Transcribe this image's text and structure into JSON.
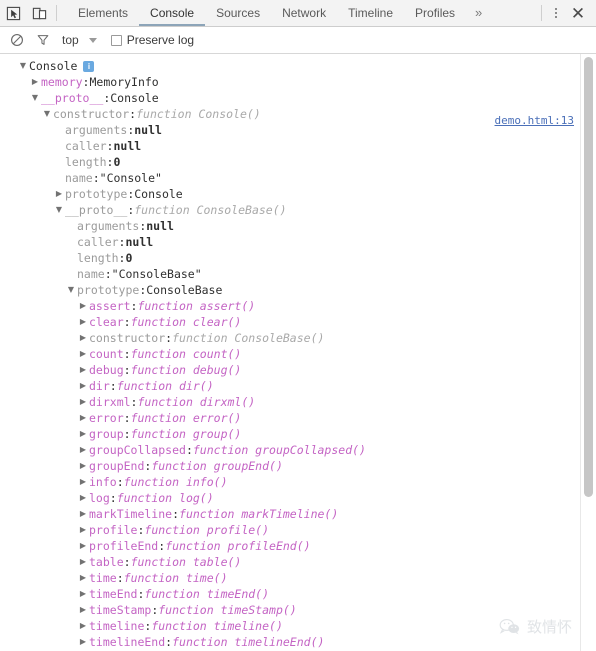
{
  "window": {
    "title": "Chrome DevTools - Console"
  },
  "toolbar": {
    "inspect_icon": "inspect-cursor-icon",
    "device_icon": "device-toolbar-icon",
    "tabs": [
      {
        "label": "Elements",
        "active": false
      },
      {
        "label": "Console",
        "active": true
      },
      {
        "label": "Sources",
        "active": false
      },
      {
        "label": "Network",
        "active": false
      },
      {
        "label": "Timeline",
        "active": false
      },
      {
        "label": "Profiles",
        "active": false
      }
    ],
    "more_tabs_label": "»",
    "menu_icon": "vertical-dots-icon",
    "close_label": "✕",
    "active_tab_underline": "#8ca4b8"
  },
  "filterbar": {
    "clear_icon": "clear-console-icon",
    "filter_icon": "filter-funnel-icon",
    "context_value": "top",
    "context_caret": "chevron-down-icon",
    "preserve_log_label": "Preserve log",
    "preserve_log_checked": false
  },
  "console": {
    "source_link": "demo.html:13",
    "lines": [
      {
        "indent": 1,
        "tri": "open",
        "name": "Console",
        "name_style": "lbl",
        "sep": "",
        "value": "",
        "value_style": "",
        "badge": "i"
      },
      {
        "indent": 2,
        "tri": "closed",
        "name": "memory",
        "name_style": "nm",
        "sep": ": ",
        "value": "MemoryInfo",
        "value_style": "val"
      },
      {
        "indent": 2,
        "tri": "open",
        "name": "__proto__",
        "name_style": "nm",
        "sep": ": ",
        "value": "Console",
        "value_style": "val"
      },
      {
        "indent": 3,
        "tri": "open",
        "name": "constructor",
        "name_style": "nm-grey",
        "sep": ": ",
        "value": "function Console()",
        "value_style": "val-fn-grey"
      },
      {
        "indent": 4,
        "tri": "none",
        "name": "arguments",
        "name_style": "nm-grey",
        "sep": ": ",
        "value": "null",
        "value_style": "val-null"
      },
      {
        "indent": 4,
        "tri": "none",
        "name": "caller",
        "name_style": "nm-grey",
        "sep": ": ",
        "value": "null",
        "value_style": "val-null"
      },
      {
        "indent": 4,
        "tri": "none",
        "name": "length",
        "name_style": "nm-grey",
        "sep": ": ",
        "value": "0",
        "value_style": "val-null"
      },
      {
        "indent": 4,
        "tri": "none",
        "name": "name",
        "name_style": "nm-grey",
        "sep": ": ",
        "value": "\"Console\"",
        "value_style": "val-str"
      },
      {
        "indent": 4,
        "tri": "closed",
        "name": "prototype",
        "name_style": "nm-grey",
        "sep": ": ",
        "value": "Console",
        "value_style": "val"
      },
      {
        "indent": 4,
        "tri": "open",
        "name": "__proto__",
        "name_style": "nm-grey",
        "sep": ": ",
        "value": "function ConsoleBase()",
        "value_style": "val-fn-grey"
      },
      {
        "indent": 5,
        "tri": "none",
        "name": "arguments",
        "name_style": "nm-grey",
        "sep": ": ",
        "value": "null",
        "value_style": "val-null"
      },
      {
        "indent": 5,
        "tri": "none",
        "name": "caller",
        "name_style": "nm-grey",
        "sep": ": ",
        "value": "null",
        "value_style": "val-null"
      },
      {
        "indent": 5,
        "tri": "none",
        "name": "length",
        "name_style": "nm-grey",
        "sep": ": ",
        "value": "0",
        "value_style": "val-null"
      },
      {
        "indent": 5,
        "tri": "none",
        "name": "name",
        "name_style": "nm-grey",
        "sep": ": ",
        "value": "\"ConsoleBase\"",
        "value_style": "val-str"
      },
      {
        "indent": 5,
        "tri": "open",
        "name": "prototype",
        "name_style": "nm-grey",
        "sep": ": ",
        "value": "ConsoleBase",
        "value_style": "val"
      },
      {
        "indent": 6,
        "tri": "closed",
        "name": "assert",
        "name_style": "nm",
        "sep": ": ",
        "value": "function assert()",
        "value_style": "val-fn"
      },
      {
        "indent": 6,
        "tri": "closed",
        "name": "clear",
        "name_style": "nm",
        "sep": ": ",
        "value": "function clear()",
        "value_style": "val-fn"
      },
      {
        "indent": 6,
        "tri": "closed",
        "name": "constructor",
        "name_style": "nm-grey",
        "sep": ": ",
        "value": "function ConsoleBase()",
        "value_style": "val-fn-grey"
      },
      {
        "indent": 6,
        "tri": "closed",
        "name": "count",
        "name_style": "nm",
        "sep": ": ",
        "value": "function count()",
        "value_style": "val-fn"
      },
      {
        "indent": 6,
        "tri": "closed",
        "name": "debug",
        "name_style": "nm",
        "sep": ": ",
        "value": "function debug()",
        "value_style": "val-fn"
      },
      {
        "indent": 6,
        "tri": "closed",
        "name": "dir",
        "name_style": "nm",
        "sep": ": ",
        "value": "function dir()",
        "value_style": "val-fn"
      },
      {
        "indent": 6,
        "tri": "closed",
        "name": "dirxml",
        "name_style": "nm",
        "sep": ": ",
        "value": "function dirxml()",
        "value_style": "val-fn"
      },
      {
        "indent": 6,
        "tri": "closed",
        "name": "error",
        "name_style": "nm",
        "sep": ": ",
        "value": "function error()",
        "value_style": "val-fn"
      },
      {
        "indent": 6,
        "tri": "closed",
        "name": "group",
        "name_style": "nm",
        "sep": ": ",
        "value": "function group()",
        "value_style": "val-fn"
      },
      {
        "indent": 6,
        "tri": "closed",
        "name": "groupCollapsed",
        "name_style": "nm",
        "sep": ": ",
        "value": "function groupCollapsed()",
        "value_style": "val-fn"
      },
      {
        "indent": 6,
        "tri": "closed",
        "name": "groupEnd",
        "name_style": "nm",
        "sep": ": ",
        "value": "function groupEnd()",
        "value_style": "val-fn"
      },
      {
        "indent": 6,
        "tri": "closed",
        "name": "info",
        "name_style": "nm",
        "sep": ": ",
        "value": "function info()",
        "value_style": "val-fn"
      },
      {
        "indent": 6,
        "tri": "closed",
        "name": "log",
        "name_style": "nm",
        "sep": ": ",
        "value": "function log()",
        "value_style": "val-fn"
      },
      {
        "indent": 6,
        "tri": "closed",
        "name": "markTimeline",
        "name_style": "nm",
        "sep": ": ",
        "value": "function markTimeline()",
        "value_style": "val-fn"
      },
      {
        "indent": 6,
        "tri": "closed",
        "name": "profile",
        "name_style": "nm",
        "sep": ": ",
        "value": "function profile()",
        "value_style": "val-fn"
      },
      {
        "indent": 6,
        "tri": "closed",
        "name": "profileEnd",
        "name_style": "nm",
        "sep": ": ",
        "value": "function profileEnd()",
        "value_style": "val-fn"
      },
      {
        "indent": 6,
        "tri": "closed",
        "name": "table",
        "name_style": "nm",
        "sep": ": ",
        "value": "function table()",
        "value_style": "val-fn"
      },
      {
        "indent": 6,
        "tri": "closed",
        "name": "time",
        "name_style": "nm",
        "sep": ": ",
        "value": "function time()",
        "value_style": "val-fn"
      },
      {
        "indent": 6,
        "tri": "closed",
        "name": "timeEnd",
        "name_style": "nm",
        "sep": ": ",
        "value": "function timeEnd()",
        "value_style": "val-fn"
      },
      {
        "indent": 6,
        "tri": "closed",
        "name": "timeStamp",
        "name_style": "nm",
        "sep": ": ",
        "value": "function timeStamp()",
        "value_style": "val-fn"
      },
      {
        "indent": 6,
        "tri": "closed",
        "name": "timeline",
        "name_style": "nm",
        "sep": ": ",
        "value": "function timeline()",
        "value_style": "val-fn"
      },
      {
        "indent": 6,
        "tri": "closed",
        "name": "timelineEnd",
        "name_style": "nm",
        "sep": ": ",
        "value": "function timelineEnd()",
        "value_style": "val-fn"
      }
    ]
  },
  "watermark": {
    "text": "致情怀"
  }
}
